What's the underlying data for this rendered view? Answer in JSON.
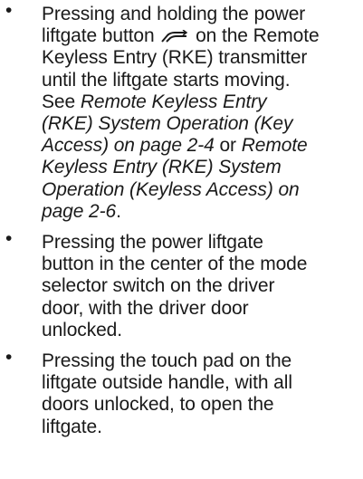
{
  "items": [
    {
      "l1": "Pressing and holding the power",
      "l2a": "liftgate button",
      "l2b": "on the Remote",
      "l3": "Keyless Entry (RKE) transmitter",
      "l4": "until the liftgate starts moving.",
      "l5": "See",
      "l5ref": "Remote Keyless Entry",
      "l6ref": "(RKE) System Operation (Key",
      "l7ref": "Access) on page 2-4",
      "l7b": "or",
      "l7ref2": "Remote",
      "l8ref": "Keyless Entry (RKE) System",
      "l9ref": "Operation (Keyless Access) on",
      "l10ref": "page 2-6",
      "l10end": "."
    },
    {
      "l1": "Pressing the power liftgate",
      "l2": "button in the center of the mode",
      "l3": "selector switch on the driver",
      "l4": "door, with the driver door",
      "l5": "unlocked."
    },
    {
      "l1": "Pressing the touch pad on the",
      "l2": "liftgate outside handle, with all",
      "l3": "doors unlocked, to open the",
      "l4": "liftgate."
    }
  ],
  "bullet_char": "•",
  "icon": "power-liftgate-icon"
}
